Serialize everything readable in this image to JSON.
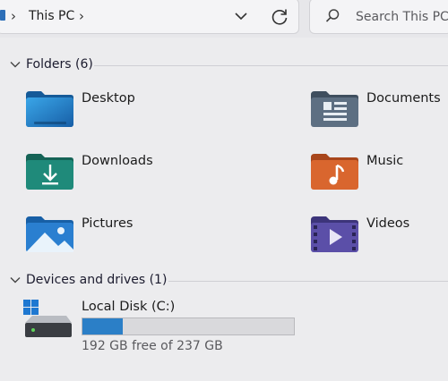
{
  "address_bar": {
    "location_label": "This PC",
    "history_dropdown_icon": "chevron-down-icon",
    "refresh_icon": "refresh-icon"
  },
  "search": {
    "placeholder": "Search This PC",
    "icon": "search-icon"
  },
  "folders": {
    "header": "Folders (6)",
    "items": [
      {
        "label": "Desktop",
        "icon": "desktop-folder-icon"
      },
      {
        "label": "Documents",
        "icon": "documents-folder-icon"
      },
      {
        "label": "Downloads",
        "icon": "downloads-folder-icon"
      },
      {
        "label": "Music",
        "icon": "music-folder-icon"
      },
      {
        "label": "Pictures",
        "icon": "pictures-folder-icon"
      },
      {
        "label": "Videos",
        "icon": "videos-folder-icon"
      }
    ]
  },
  "devices": {
    "header": "Devices and drives (1)",
    "drives": [
      {
        "label": "Local Disk (C:)",
        "free_text": "192 GB free of 237 GB",
        "used_fraction": 0.19,
        "icon": "local-disk-icon"
      }
    ]
  },
  "colors": {
    "accent": "#2b7fc7",
    "desktop": "#1f6fb6",
    "documents": "#5d6f82",
    "downloads": "#1f8a7a",
    "music": "#d9662e",
    "pictures": "#2a7fd0",
    "videos": "#5b4fa8"
  }
}
